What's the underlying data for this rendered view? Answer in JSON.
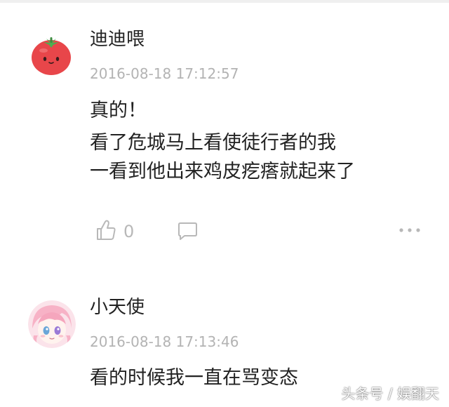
{
  "comments": [
    {
      "username": "迪迪喂",
      "avatar_icon": "tomato-avatar",
      "timestamp": "2016-08-18 17:12:57",
      "lines": [
        "真的！",
        "看了危城马上看使徒行者的我",
        "一看到他出来鸡皮疙瘩就起来了"
      ],
      "like_icon": "thumbs-up-icon",
      "like_count": "0",
      "reply_icon": "comment-bubble-icon",
      "more_icon": "more-dots-icon"
    },
    {
      "username": "小天使",
      "avatar_icon": "anime-girl-avatar",
      "timestamp": "2016-08-18 17:13:46",
      "lines": [
        "看的时候我一直在骂变态"
      ]
    }
  ],
  "watermark": "头条号 / 娱翻天",
  "colors": {
    "text": "#222222",
    "meta": "#b3b3b3",
    "icon": "#b8b8b8",
    "tomato_red": "#e8464a"
  }
}
